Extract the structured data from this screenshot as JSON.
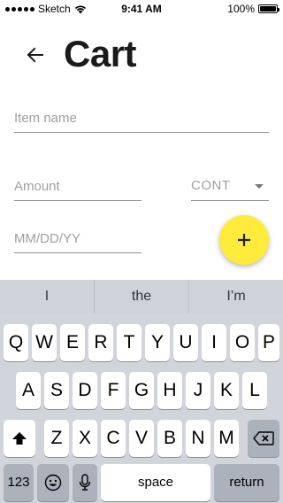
{
  "status_bar": {
    "carrier": "Sketch",
    "time": "9:41 AM",
    "battery": "100%",
    "battery_level": 1.0
  },
  "header": {
    "title": "Cart",
    "back_icon": "arrow-left-icon"
  },
  "form": {
    "item_name_placeholder": "Item name",
    "amount_placeholder": "Amount",
    "unit_value": "CONT",
    "date_placeholder": "MM/DD/YY"
  },
  "fab": {
    "icon": "plus-icon",
    "color": "#ffeb3b"
  },
  "keyboard": {
    "suggestions": [
      "I",
      "the",
      "I’m"
    ],
    "row1": [
      "Q",
      "W",
      "E",
      "R",
      "T",
      "Y",
      "U",
      "I",
      "O",
      "P"
    ],
    "row2": [
      "A",
      "S",
      "D",
      "F",
      "G",
      "H",
      "J",
      "K",
      "L"
    ],
    "row3": [
      "Z",
      "X",
      "C",
      "V",
      "B",
      "N",
      "M"
    ],
    "numbers_label": "123",
    "space_label": "space",
    "return_label": "return",
    "shift_icon": "shift-icon",
    "delete_icon": "backspace-icon",
    "emoji_icon": "emoji-icon",
    "mic_icon": "microphone-icon"
  }
}
